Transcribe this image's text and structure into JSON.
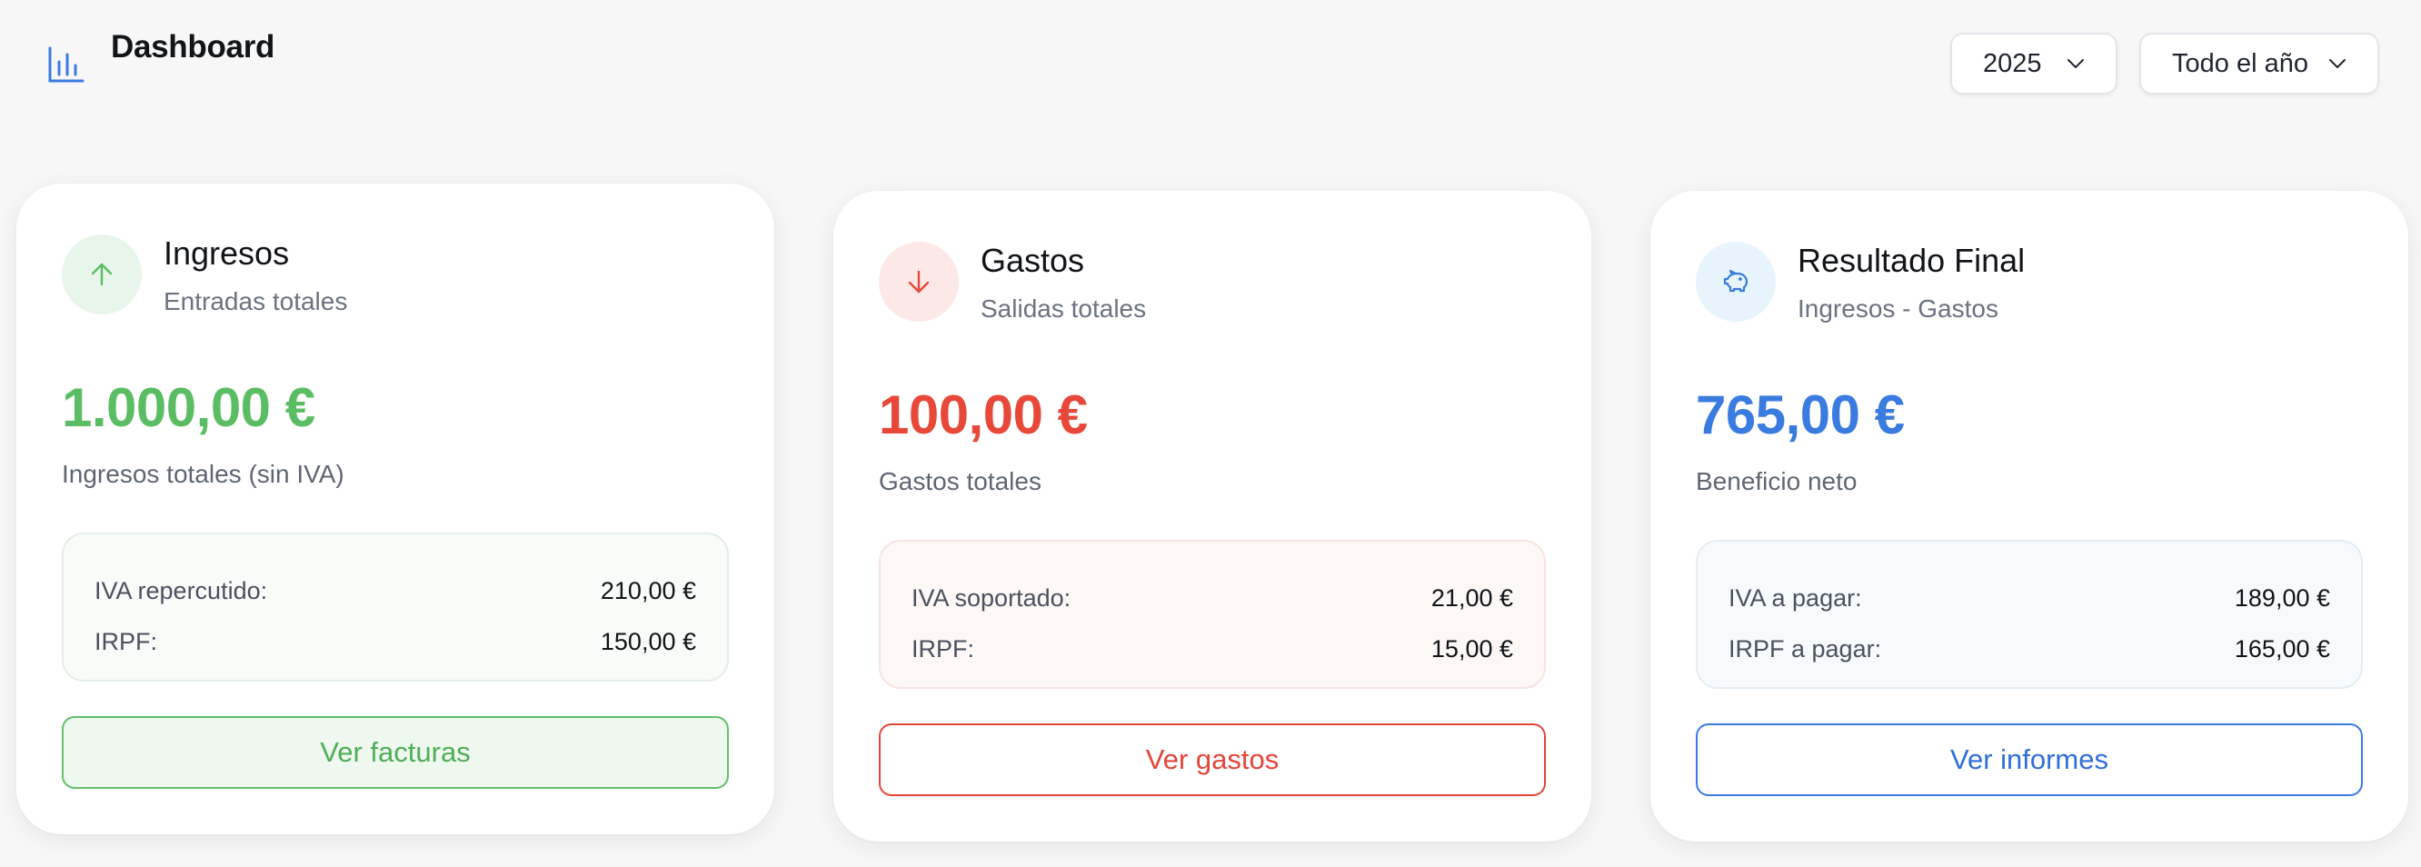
{
  "header": {
    "title": "Dashboard",
    "year_select": "2025",
    "period_select": "Todo el año"
  },
  "cards": [
    {
      "title": "Ingresos",
      "subtitle": "Entradas totales",
      "amount": "1.000,00 €",
      "amount_label": "Ingresos totales (sin IVA)",
      "details": [
        {
          "label": "IVA repercutido:",
          "value": "210,00 €"
        },
        {
          "label": "IRPF:",
          "value": "150,00 €"
        }
      ],
      "button": "Ver facturas",
      "icon": "arrow-up-icon",
      "accent": "#5bbd63"
    },
    {
      "title": "Gastos",
      "subtitle": "Salidas totales",
      "amount": "100,00 €",
      "amount_label": "Gastos totales",
      "details": [
        {
          "label": "IVA soportado:",
          "value": "21,00 €"
        },
        {
          "label": "IRPF:",
          "value": "15,00 €"
        }
      ],
      "button": "Ver gastos",
      "icon": "arrow-down-icon",
      "accent": "#e8483a"
    },
    {
      "title": "Resultado Final",
      "subtitle": "Ingresos - Gastos",
      "amount": "765,00 €",
      "amount_label": "Beneficio neto",
      "details": [
        {
          "label": "IVA a pagar:",
          "value": "189,00 €"
        },
        {
          "label": "IRPF a pagar:",
          "value": "165,00 €"
        }
      ],
      "button": "Ver informes",
      "icon": "piggy-bank-icon",
      "accent": "#3a7be0"
    }
  ]
}
